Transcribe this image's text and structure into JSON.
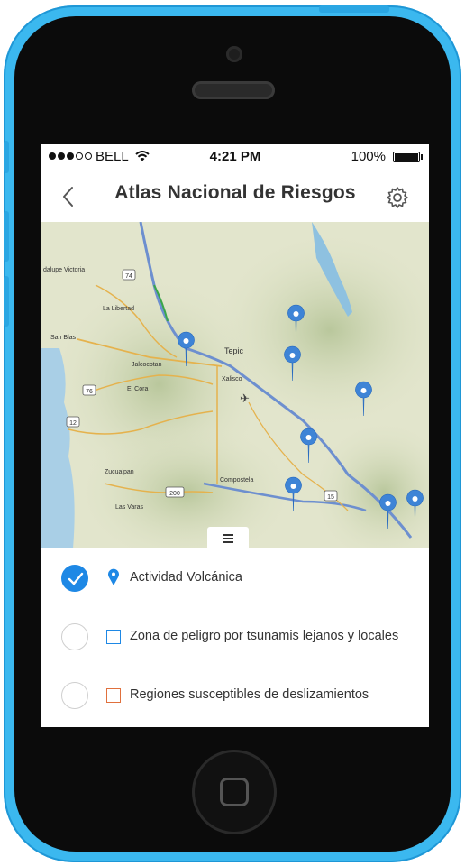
{
  "status_bar": {
    "carrier": "BELL",
    "time": "4:21 PM",
    "battery": "100%"
  },
  "nav": {
    "title": "Atlas Nacional de Riesgos"
  },
  "map": {
    "places": [
      "dalupe Victoria",
      "La Libertad",
      "San Blas",
      "Jalcocotan",
      "El Cora",
      "Tepic",
      "Xalisco",
      "Compostela",
      "Zucualpan",
      "Las Varas"
    ],
    "road_shields": [
      "74",
      "76",
      "12",
      "200",
      "15"
    ],
    "marker_count": 8
  },
  "layers": [
    {
      "label": "Actividad Volcánica",
      "checked": true,
      "icon": "location-pin-icon",
      "color": "#1e88e5"
    },
    {
      "label": "Zona de peligro por tsunamis lejanos y locales",
      "checked": false,
      "icon": "square-outline-icon",
      "color": "#1e88e5"
    },
    {
      "label": "Regiones susceptibles de deslizamientos",
      "checked": false,
      "icon": "square-outline-icon",
      "color": "#e0703d"
    }
  ],
  "colors": {
    "accent": "#1e88e5",
    "phone_shell": "#3bb8ef"
  }
}
